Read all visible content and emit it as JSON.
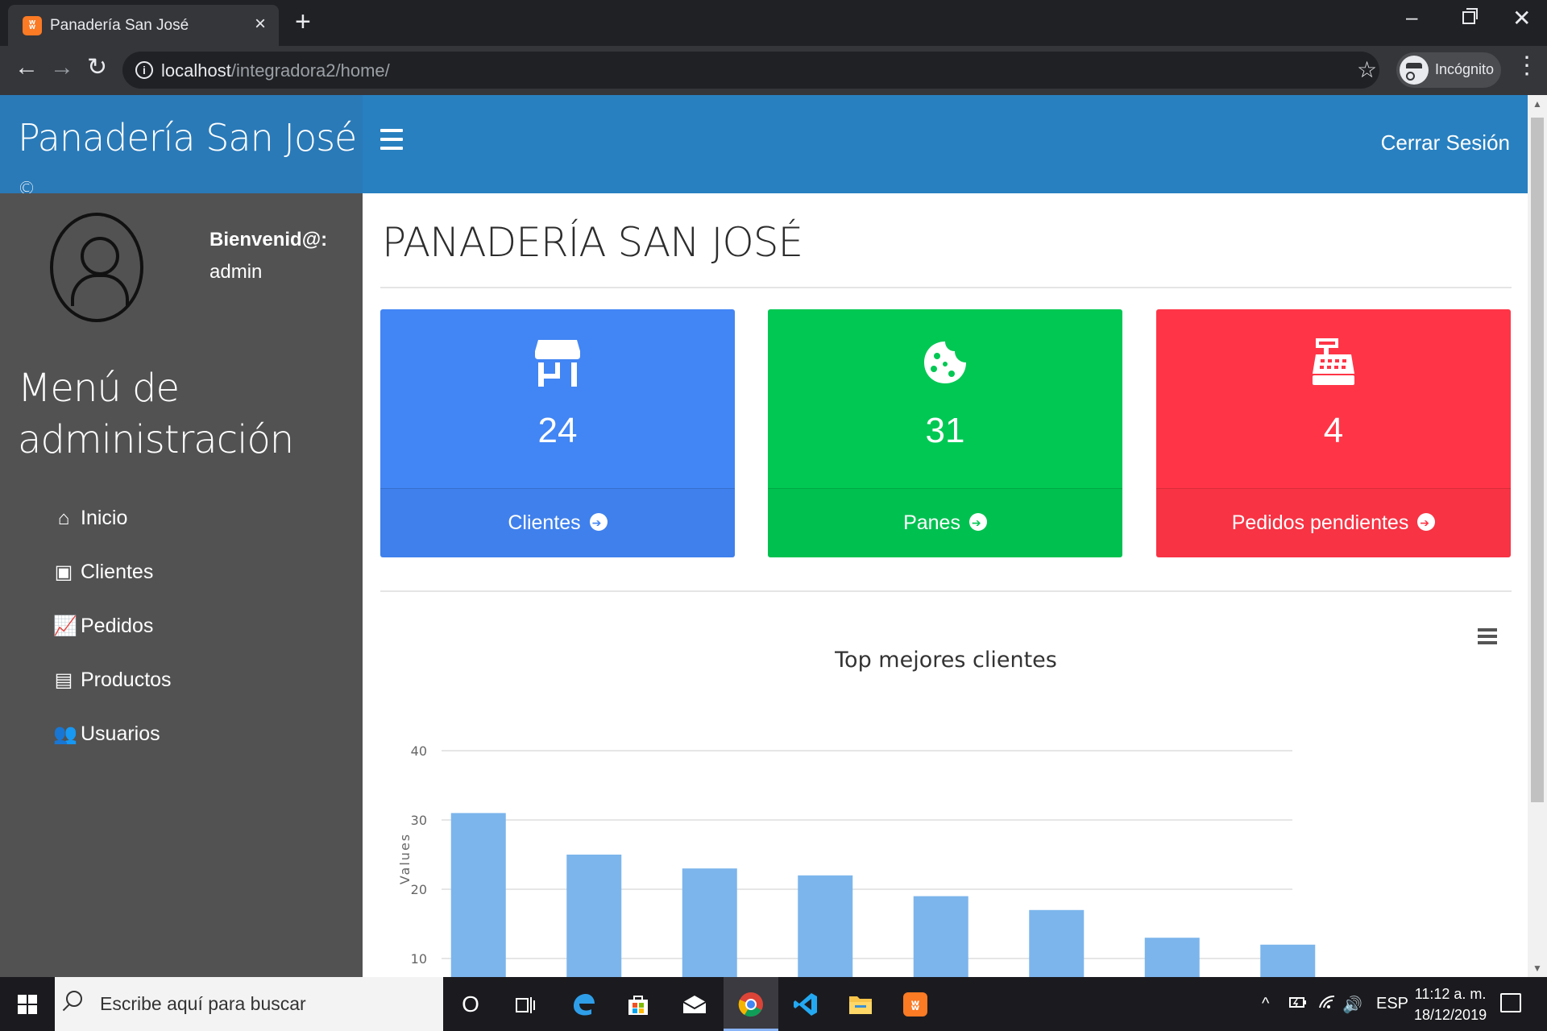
{
  "browser": {
    "tab_title": "Panadería San José",
    "tab_close": "×",
    "tab_new": "+",
    "url_host": "localhost",
    "url_path": "/integradora2/home/",
    "incognito_label": "Incógnito",
    "window_minimize": "–",
    "window_close": "✕",
    "back": "←",
    "forward": "→",
    "reload": "↻",
    "info": "i",
    "star": "☆",
    "menu": "⋮"
  },
  "app": {
    "brand": "Panadería San José",
    "brand_mark": "©",
    "logout": "Cerrar Sesión"
  },
  "sidebar": {
    "welcome": "Bienvenid@:",
    "username": "admin",
    "menu_title": "Menú de administración",
    "items": [
      {
        "label": "Inicio",
        "icon": "home-icon",
        "glyph": "⌂"
      },
      {
        "label": "Clientes",
        "icon": "address-card-icon",
        "glyph": "▣"
      },
      {
        "label": "Pedidos",
        "icon": "line-chart-icon",
        "glyph": "📈"
      },
      {
        "label": "Productos",
        "icon": "box-icon",
        "glyph": "▤"
      },
      {
        "label": "Usuarios",
        "icon": "users-icon",
        "glyph": "👥"
      }
    ]
  },
  "main": {
    "title": "PANADERÍA SAN JOSÉ",
    "cards": [
      {
        "count": "24",
        "label": "Clientes",
        "icon": "store-icon",
        "color": "#4285f4"
      },
      {
        "count": "31",
        "label": "Panes",
        "icon": "cookie-icon",
        "color": "#00c853"
      },
      {
        "count": "4",
        "label": "Pedidos pendientes",
        "icon": "cash-register-icon",
        "color": "#ff3547"
      }
    ]
  },
  "chart_data": {
    "type": "bar",
    "title": "Top mejores clientes",
    "ylabel": "Values",
    "xlabel": "",
    "ylim": [
      0,
      40
    ],
    "yticks": [
      10,
      20,
      30,
      40
    ],
    "values": [
      31,
      25,
      23,
      22,
      19,
      17,
      13,
      12
    ],
    "color": "#7cb5ec",
    "grid": true
  },
  "taskbar": {
    "search_placeholder": "Escribe aquí para buscar",
    "language": "ESP",
    "time": "11:12 a. m.",
    "date": "18/12/2019",
    "cortana": "O",
    "tray_chevron": "^",
    "volume": "🔊"
  }
}
